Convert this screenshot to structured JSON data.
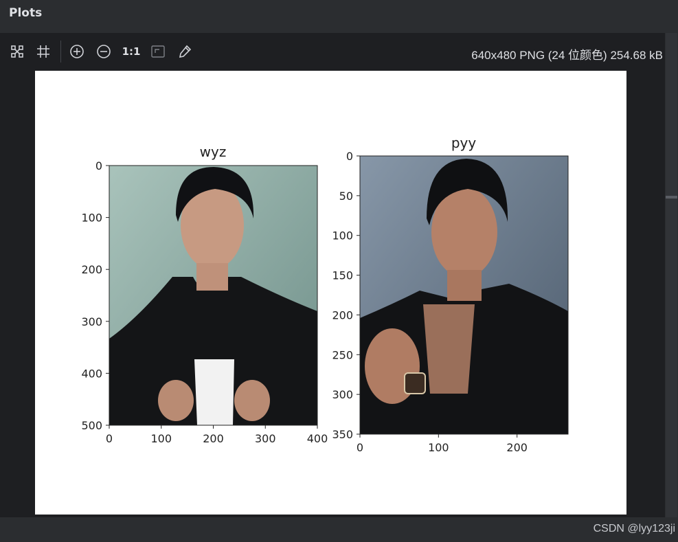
{
  "window": {
    "title": "Plots"
  },
  "toolbar": {
    "actual_size_label": "1:1",
    "image_info": "640x480 PNG (24 位颜色) 254.68 kB",
    "icons": [
      "fit-grid-icon",
      "grid-icon",
      "zoom-in-icon",
      "zoom-out-icon",
      "actual-size",
      "background-icon",
      "color-picker-icon"
    ]
  },
  "figure": {
    "subplots": [
      {
        "title": "wyz",
        "image_desc": "portrait photo",
        "x_ticks": [
          "0",
          "100",
          "200",
          "300",
          "400"
        ],
        "y_ticks": [
          "0",
          "100",
          "200",
          "300",
          "400",
          "500"
        ],
        "x_range": [
          0,
          400
        ],
        "y_range": [
          0,
          500
        ],
        "bg_colors": [
          "#a9c3bb",
          "#6f8f89"
        ]
      },
      {
        "title": "pyy",
        "image_desc": "portrait photo",
        "x_ticks": [
          "0",
          "100",
          "200"
        ],
        "y_ticks": [
          "0",
          "50",
          "100",
          "150",
          "200",
          "250",
          "300",
          "350"
        ],
        "x_range": [
          0,
          265
        ],
        "y_range": [
          0,
          350
        ],
        "bg_colors": [
          "#8797a8",
          "#4d5c6d"
        ]
      }
    ]
  },
  "watermark": "CSDN @lyy123ji",
  "colors": {
    "panel": "#2b2d30",
    "background": "#1e1f22",
    "text": "#dfe1e5"
  }
}
